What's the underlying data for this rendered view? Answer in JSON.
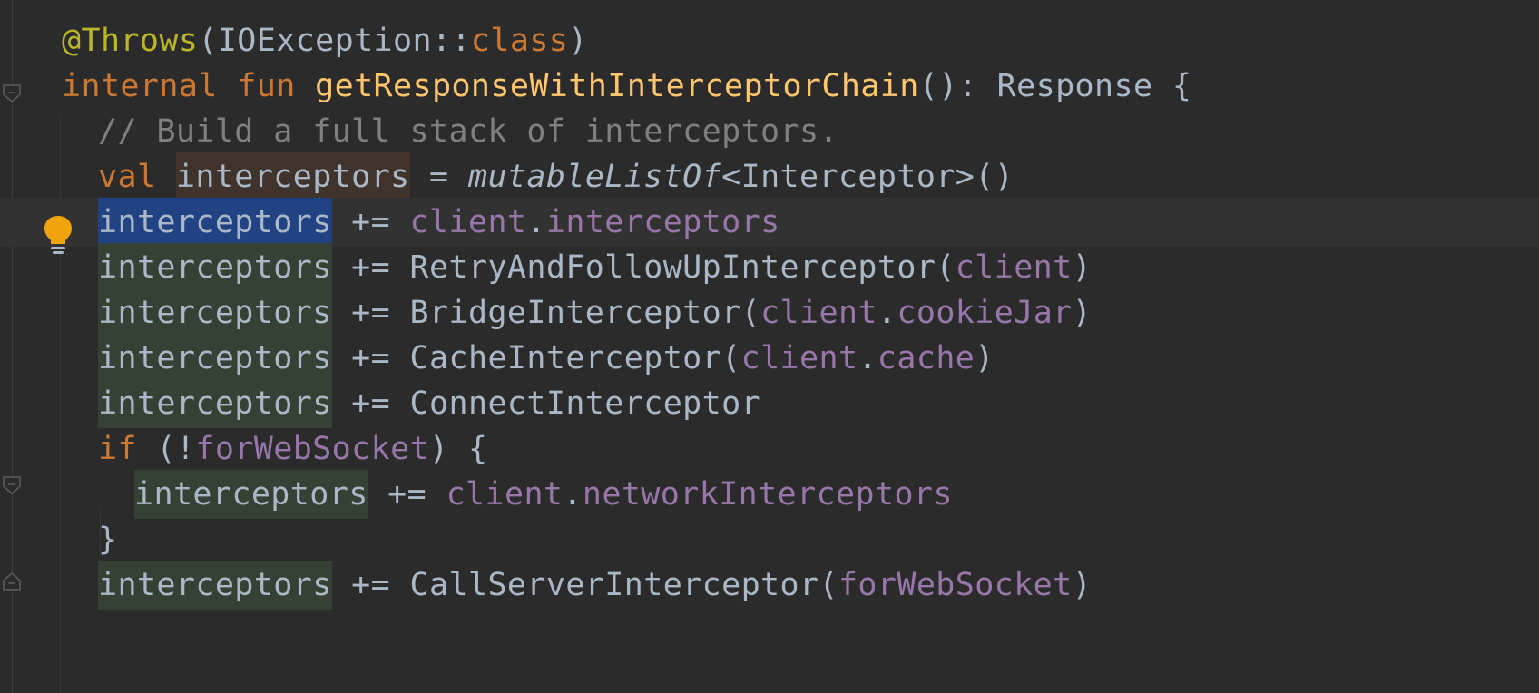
{
  "editor": {
    "lines": [
      {
        "tokens": [
          {
            "t": "@Throws",
            "c": "ann"
          },
          {
            "t": "(IOException::",
            "c": "plain"
          },
          {
            "t": "class",
            "c": "kw"
          },
          {
            "t": ")",
            "c": "plain"
          }
        ]
      },
      {
        "tokens": [
          {
            "t": "internal fun ",
            "c": "kw"
          },
          {
            "t": "getResponseWithInterceptorChain",
            "c": "fn"
          },
          {
            "t": "(): Response {",
            "c": "plain"
          }
        ]
      },
      {
        "tokens": [
          {
            "t": "// Build a full stack of interceptors.",
            "c": "cmt"
          }
        ]
      },
      {
        "tokens": [
          {
            "t": "val ",
            "c": "kw"
          },
          {
            "t": "interceptors",
            "c": "plain hl-decl"
          },
          {
            "t": " = ",
            "c": "plain"
          },
          {
            "t": "mutableListOf",
            "c": "plain ital"
          },
          {
            "t": "<Interceptor>()",
            "c": "plain"
          }
        ]
      },
      {
        "tokens": [
          {
            "t": "interceptors",
            "c": "plain hl-caret"
          },
          {
            "t": " += ",
            "c": "plain"
          },
          {
            "t": "client",
            "c": "prop"
          },
          {
            "t": ".",
            "c": "plain"
          },
          {
            "t": "interceptors",
            "c": "prop"
          }
        ]
      },
      {
        "tokens": [
          {
            "t": "interceptors",
            "c": "plain hl-read"
          },
          {
            "t": " += RetryAndFollowUpInterceptor(",
            "c": "plain"
          },
          {
            "t": "client",
            "c": "prop"
          },
          {
            "t": ")",
            "c": "plain"
          }
        ]
      },
      {
        "tokens": [
          {
            "t": "interceptors",
            "c": "plain hl-read"
          },
          {
            "t": " += BridgeInterceptor(",
            "c": "plain"
          },
          {
            "t": "client",
            "c": "prop"
          },
          {
            "t": ".",
            "c": "plain"
          },
          {
            "t": "cookieJar",
            "c": "prop"
          },
          {
            "t": ")",
            "c": "plain"
          }
        ]
      },
      {
        "tokens": [
          {
            "t": "interceptors",
            "c": "plain hl-read"
          },
          {
            "t": " += CacheInterceptor(",
            "c": "plain"
          },
          {
            "t": "client",
            "c": "prop"
          },
          {
            "t": ".",
            "c": "plain"
          },
          {
            "t": "cache",
            "c": "prop"
          },
          {
            "t": ")",
            "c": "plain"
          }
        ]
      },
      {
        "tokens": [
          {
            "t": "interceptors",
            "c": "plain hl-read"
          },
          {
            "t": " += ConnectInterceptor",
            "c": "plain"
          }
        ]
      },
      {
        "tokens": [
          {
            "t": "if ",
            "c": "kw"
          },
          {
            "t": "(!",
            "c": "plain"
          },
          {
            "t": "forWebSocket",
            "c": "prop"
          },
          {
            "t": ") {",
            "c": "plain"
          }
        ]
      },
      {
        "tokens": [
          {
            "t": "interceptors",
            "c": "plain hl-read"
          },
          {
            "t": " += ",
            "c": "plain"
          },
          {
            "t": "client",
            "c": "prop"
          },
          {
            "t": ".",
            "c": "plain"
          },
          {
            "t": "networkInterceptors",
            "c": "prop"
          }
        ]
      },
      {
        "tokens": [
          {
            "t": "}",
            "c": "plain"
          }
        ]
      },
      {
        "tokens": [
          {
            "t": "interceptors",
            "c": "plain hl-read"
          },
          {
            "t": " += CallServerInterceptor(",
            "c": "plain"
          },
          {
            "t": "forWebSocket",
            "c": "prop"
          },
          {
            "t": ")",
            "c": "plain"
          }
        ]
      }
    ],
    "caret_line": 5,
    "gutter_icons": [
      "fold-open-icon",
      "lightbulb-icon",
      "fold-open-icon",
      "fold-close-icon"
    ]
  },
  "colors": {
    "background": "#2b2b2b",
    "keyword": "#cc7832",
    "function": "#ffc66d",
    "annotation": "#bbb529",
    "comment": "#808080",
    "property": "#9876aa",
    "text": "#a9b7c6",
    "caret_highlight": "#214283",
    "read_highlight": "#344134",
    "write_highlight": "#40332b",
    "bulb": "#f0a30a"
  }
}
